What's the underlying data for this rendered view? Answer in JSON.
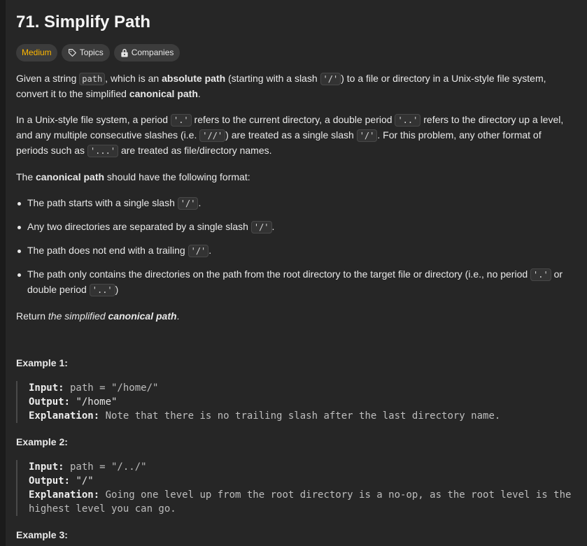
{
  "problem": {
    "title": "71. Simplify Path",
    "difficulty": "Medium",
    "topics_label": "Topics",
    "companies_label": "Companies"
  },
  "desc": {
    "p1": {
      "a": "Given a string ",
      "code1": "path",
      "b": ", which is an ",
      "bold1": "absolute path",
      "c": " (starting with a slash ",
      "code2": "'/'",
      "d": ") to a file or directory in a Unix-style file system, convert it to the simplified ",
      "bold2": "canonical path",
      "e": "."
    },
    "p2": {
      "a": "In a Unix-style file system, a period ",
      "code1": "'.'",
      "b": " refers to the current directory, a double period ",
      "code2": "'..'",
      "c": " refers to the directory up a level, and any multiple consecutive slashes (i.e. ",
      "code3": "'//'",
      "d": ") are treated as a single slash ",
      "code4": "'/'",
      "e": ". For this problem, any other format of periods such as ",
      "code5": "'...'",
      "f": " are treated as file/directory names."
    },
    "p3": {
      "a": "The ",
      "bold": "canonical path",
      "b": " should have the following format:"
    },
    "rules": {
      "r1": {
        "text": "The path starts with a single slash ",
        "code": "'/'",
        "end": "."
      },
      "r2": {
        "text": "Any two directories are separated by a single slash ",
        "code": "'/'",
        "end": "."
      },
      "r3": {
        "text": "The path does not end with a trailing ",
        "code": "'/'",
        "end": "."
      },
      "r4": {
        "text": "The path only contains the directories on the path from the root directory to the target file or directory (i.e., no period ",
        "code1": "'.'",
        "mid": " or double period ",
        "code2": "'..'",
        "end": ")"
      }
    },
    "p4": {
      "a": "Return ",
      "italic": "the simplified ",
      "bold_italic": "canonical path",
      "end": "."
    }
  },
  "examples": [
    {
      "title": "Example 1:",
      "input_label": "Input:",
      "input": " path = \"/home/\"",
      "output_label": "Output:",
      "output": " \"/home\"",
      "explanation_label": "Explanation:",
      "explanation": " Note that there is no trailing slash after the last directory name."
    },
    {
      "title": "Example 2:",
      "input_label": "Input:",
      "input": " path = \"/../\"",
      "output_label": "Output:",
      "output": " \"/\"",
      "explanation_label": "Explanation:",
      "explanation": " Going one level up from the root directory is a no-op, as the root level is the highest level you can go."
    },
    {
      "title": "Example 3:"
    }
  ],
  "colors": {
    "difficulty_medium": "#ffb700",
    "panel_bg": "#262626",
    "badge_bg": "#3c3c3c"
  },
  "icons": {
    "topics": "tag-icon",
    "companies": "lock-icon"
  }
}
